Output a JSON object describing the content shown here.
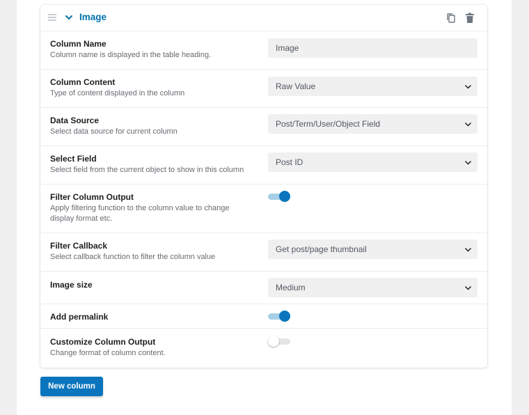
{
  "column_card": {
    "title": "Image",
    "fields": {
      "column_name": {
        "label": "Column Name",
        "description": "Column name is displayed in the table heading.",
        "value": "Image"
      },
      "column_content": {
        "label": "Column Content",
        "description": "Type of content displayed in the column",
        "value": "Raw Value"
      },
      "data_source": {
        "label": "Data Source",
        "description": "Select data source for current column",
        "value": "Post/Term/User/Object Field"
      },
      "select_field": {
        "label": "Select Field",
        "description": "Select field from the current object to show in this column",
        "value": "Post ID"
      },
      "filter_output": {
        "label": "Filter Column Output",
        "description": "Apply filtering function to the column value to change display format etc.",
        "enabled": true
      },
      "filter_callback": {
        "label": "Filter Callback",
        "description": "Select callback function to filter the column value",
        "value": "Get post/page thumbnail"
      },
      "image_size": {
        "label": "Image size",
        "value": "Medium"
      },
      "add_permalink": {
        "label": "Add permalink",
        "enabled": true
      },
      "customize_output": {
        "label": "Customize Column Output",
        "description": "Change format of column content.",
        "enabled": false
      }
    }
  },
  "actions": {
    "new_column_label": "New column"
  },
  "colors": {
    "accent": "#0a75bd",
    "title": "#0073aa"
  },
  "icons": [
    "drag-handle-icon",
    "chevron-down-icon",
    "copy-icon",
    "trash-icon"
  ]
}
